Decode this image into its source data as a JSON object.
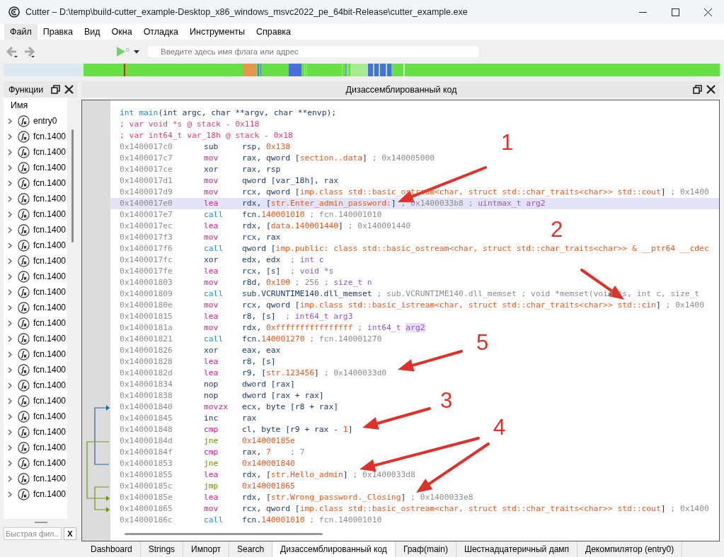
{
  "window": {
    "title": "Cutter – D:\\temp\\build-cutter_example-Desktop_x86_windows_msvc2022_pe_64bit-Release\\cutter_example.exe"
  },
  "menu": [
    {
      "label": "Файл",
      "selected": true
    },
    {
      "label": "Правка",
      "selected": false
    },
    {
      "label": "Вид",
      "selected": false
    },
    {
      "label": "Окна",
      "selected": false
    },
    {
      "label": "Отладка",
      "selected": false
    },
    {
      "label": "Инструменты",
      "selected": false
    },
    {
      "label": "Справка",
      "selected": false
    }
  ],
  "toolbar": {
    "debug_badge": "D",
    "search": {
      "placeholder": "Введите здесь имя флага или адрес"
    }
  },
  "functions_panel": {
    "title": "Функции",
    "column": "Имя",
    "items": [
      {
        "name": "entry0",
        "expanded": false
      },
      {
        "name": "fcn.1400",
        "expanded": false
      },
      {
        "name": "fcn.1400",
        "expanded": false
      },
      {
        "name": "fcn.1400",
        "expanded": false
      },
      {
        "name": "fcn.1400",
        "expanded": false
      },
      {
        "name": "fcn.1400",
        "expanded": false
      },
      {
        "name": "fcn.1400",
        "expanded": false
      },
      {
        "name": "fcn.1400",
        "expanded": false
      },
      {
        "name": "fcn.1400",
        "expanded": false
      },
      {
        "name": "fcn.1400",
        "expanded": false
      },
      {
        "name": "fcn.1400",
        "expanded": false
      },
      {
        "name": "fcn.1400",
        "expanded": false
      },
      {
        "name": "fcn.1400",
        "expanded": false
      },
      {
        "name": "fcn.1400",
        "expanded": false
      },
      {
        "name": "fcn.1400",
        "expanded": false
      },
      {
        "name": "fcn.1400",
        "expanded": false
      },
      {
        "name": "fcn.1400",
        "expanded": false
      },
      {
        "name": "fcn.1400",
        "expanded": false
      },
      {
        "name": "fcn.1400",
        "expanded": false
      },
      {
        "name": "fcn.1400",
        "expanded": false
      },
      {
        "name": "fcn.1400",
        "expanded": false
      },
      {
        "name": "fcn.1400",
        "expanded": false
      },
      {
        "name": "fcn.1400",
        "expanded": false
      },
      {
        "name": "fcn.1400",
        "expanded": false
      },
      {
        "name": "fcn.1400",
        "expanded": false
      }
    ],
    "filter": {
      "placeholder": "Быстрая фил..."
    },
    "clear_button": "X"
  },
  "disassembly": {
    "title": "Дизассемблированный код",
    "header": [
      [
        {
          "text": "int main",
          "kind": "kw"
        },
        {
          "text": "(int argc, char **argv, char **envp);",
          "kind": "reg"
        }
      ],
      [
        {
          "text": "; var void *s @ stack - 0x118",
          "kind": "var"
        }
      ],
      [
        {
          "text": "; var int64_t var_18h @ stack - 0x18",
          "kind": "var"
        }
      ]
    ],
    "rows": [
      {
        "address": "0x1400017c0",
        "mnemonic": "sub",
        "kind": "arith",
        "selected": false,
        "ops": [
          {
            "text": "rsp, ",
            "kind": "reg"
          },
          {
            "text": "0x138",
            "kind": "num"
          }
        ]
      },
      {
        "address": "0x1400017c7",
        "mnemonic": "mov",
        "kind": "move",
        "selected": false,
        "ops": [
          {
            "text": "rax, qword [",
            "kind": "reg"
          },
          {
            "text": "section..data",
            "kind": "num"
          },
          {
            "text": "]",
            "kind": "reg"
          },
          {
            "text": " ; 0x140005000",
            "kind": "cmt"
          }
        ]
      },
      {
        "address": "0x1400017ce",
        "mnemonic": "xor",
        "kind": "arith",
        "selected": false,
        "ops": [
          {
            "text": "rax, rsp",
            "kind": "reg"
          }
        ]
      },
      {
        "address": "0x1400017d1",
        "mnemonic": "mov",
        "kind": "move",
        "selected": false,
        "ops": [
          {
            "text": "qword [var_18h], rax",
            "kind": "reg"
          }
        ]
      },
      {
        "address": "0x1400017d9",
        "mnemonic": "mov",
        "kind": "move",
        "selected": false,
        "ops": [
          {
            "text": "rcx, qword [",
            "kind": "reg"
          },
          {
            "text": "imp.class std::basic_ostream<char, struct std::char_traits<char>> std::cout",
            "kind": "num"
          },
          {
            "text": "]",
            "kind": "reg"
          },
          {
            "text": " ; 0x1400",
            "kind": "cmt"
          }
        ]
      },
      {
        "address": "0x1400017e0",
        "mnemonic": "lea",
        "kind": "move",
        "selected": true,
        "ops": [
          {
            "text": "rdx, [",
            "kind": "reg"
          },
          {
            "text": "str.Enter_admin_password:",
            "kind": "num"
          },
          {
            "text": "]",
            "kind": "reg"
          },
          {
            "text": " ; 0x1400033b8 ;",
            "kind": "cmt"
          },
          {
            "text": " uintmax_t ",
            "kind": "type"
          },
          {
            "text": "arg2",
            "kind": "arg"
          }
        ]
      },
      {
        "address": "0x1400017e7",
        "mnemonic": "call",
        "kind": "call",
        "selected": false,
        "ops": [
          {
            "text": "fcn.",
            "kind": "reg"
          },
          {
            "text": "140001010",
            "kind": "num"
          },
          {
            "text": " ; fcn.140001010",
            "kind": "cmt"
          }
        ]
      },
      {
        "address": "0x1400017ec",
        "mnemonic": "lea",
        "kind": "move",
        "selected": false,
        "ops": [
          {
            "text": "rdx, [",
            "kind": "reg"
          },
          {
            "text": "data.140001440",
            "kind": "num"
          },
          {
            "text": "]",
            "kind": "reg"
          },
          {
            "text": " ; 0x140001440",
            "kind": "cmt"
          }
        ]
      },
      {
        "address": "0x1400017f3",
        "mnemonic": "mov",
        "kind": "move",
        "selected": false,
        "ops": [
          {
            "text": "rcx, rax",
            "kind": "reg"
          }
        ]
      },
      {
        "address": "0x1400017f6",
        "mnemonic": "call",
        "kind": "call",
        "selected": false,
        "ops": [
          {
            "text": "qword [",
            "kind": "reg"
          },
          {
            "text": "imp.public: class std::basic_ostream<char, struct std::char_traits<char>> & __ptr64 __cdec",
            "kind": "num"
          }
        ]
      },
      {
        "address": "0x1400017fc",
        "mnemonic": "xor",
        "kind": "arith",
        "selected": false,
        "ops": [
          {
            "text": "edx, edx",
            "kind": "reg"
          },
          {
            "text": "  ;",
            "kind": "cmt"
          },
          {
            "text": " int c",
            "kind": "type"
          }
        ]
      },
      {
        "address": "0x1400017fe",
        "mnemonic": "lea",
        "kind": "move",
        "selected": false,
        "ops": [
          {
            "text": "rcx, [s]",
            "kind": "reg"
          },
          {
            "text": "  ;",
            "kind": "cmt"
          },
          {
            "text": " void *s",
            "kind": "type"
          }
        ]
      },
      {
        "address": "0x140001803",
        "mnemonic": "mov",
        "kind": "move",
        "selected": false,
        "ops": [
          {
            "text": "r8d, ",
            "kind": "reg"
          },
          {
            "text": "0x100",
            "kind": "num"
          },
          {
            "text": " ; 256 ;",
            "kind": "cmt"
          },
          {
            "text": " size_t n",
            "kind": "type"
          }
        ]
      },
      {
        "address": "0x140001809",
        "mnemonic": "call",
        "kind": "call",
        "selected": false,
        "ops": [
          {
            "text": "sub.VCRUNTIME140.dll_memset",
            "kind": "reg"
          },
          {
            "text": " ; sub.VCRUNTIME140.dll_memset ; void *memset(void *s, int c, size_t",
            "kind": "cmt"
          }
        ]
      },
      {
        "address": "0x14000180e",
        "mnemonic": "mov",
        "kind": "move",
        "selected": false,
        "ops": [
          {
            "text": "rcx, qword [",
            "kind": "reg"
          },
          {
            "text": "imp.class std::basic_istream<char, struct std::char_traits<char>> std::cin",
            "kind": "num"
          },
          {
            "text": "]",
            "kind": "reg"
          },
          {
            "text": " ; 0x1400",
            "kind": "cmt"
          }
        ]
      },
      {
        "address": "0x140001815",
        "mnemonic": "lea",
        "kind": "move",
        "selected": false,
        "ops": [
          {
            "text": "r8, [s]",
            "kind": "reg"
          },
          {
            "text": "  ;",
            "kind": "cmt"
          },
          {
            "text": " int64_t arg3",
            "kind": "type"
          }
        ]
      },
      {
        "address": "0x14000181a",
        "mnemonic": "mov",
        "kind": "move",
        "selected": false,
        "ops": [
          {
            "text": "rdx, ",
            "kind": "reg"
          },
          {
            "text": "0xffffffffffffffff",
            "kind": "num"
          },
          {
            "text": " ;",
            "kind": "cmt"
          },
          {
            "text": " int64_t ",
            "kind": "type"
          },
          {
            "text": "arg2",
            "kind": "arg"
          }
        ]
      },
      {
        "address": "0x140001821",
        "mnemonic": "call",
        "kind": "call",
        "selected": false,
        "ops": [
          {
            "text": "fcn.",
            "kind": "reg"
          },
          {
            "text": "140001270",
            "kind": "num"
          },
          {
            "text": " ; fcn.140001270",
            "kind": "cmt"
          }
        ]
      },
      {
        "address": "0x140001826",
        "mnemonic": "xor",
        "kind": "arith",
        "selected": false,
        "ops": [
          {
            "text": "eax, eax",
            "kind": "reg"
          }
        ]
      },
      {
        "address": "0x140001828",
        "mnemonic": "lea",
        "kind": "move",
        "selected": false,
        "ops": [
          {
            "text": "r8, [s]",
            "kind": "reg"
          }
        ]
      },
      {
        "address": "0x14000182d",
        "mnemonic": "lea",
        "kind": "move",
        "selected": false,
        "ops": [
          {
            "text": "r9, [",
            "kind": "reg"
          },
          {
            "text": "str.123456",
            "kind": "num"
          },
          {
            "text": "]",
            "kind": "reg"
          },
          {
            "text": " ; 0x1400033d0",
            "kind": "cmt"
          }
        ]
      },
      {
        "address": "0x140001834",
        "mnemonic": "nop",
        "kind": "arith",
        "selected": false,
        "ops": [
          {
            "text": "dword [rax]",
            "kind": "reg"
          }
        ]
      },
      {
        "address": "0x140001838",
        "mnemonic": "nop",
        "kind": "arith",
        "selected": false,
        "ops": [
          {
            "text": "dword [rax + rax]",
            "kind": "reg"
          }
        ]
      },
      {
        "address": "0x140001840",
        "mnemonic": "movzx",
        "kind": "move",
        "selected": false,
        "ops": [
          {
            "text": "ecx, byte [r8 + rax]",
            "kind": "reg"
          }
        ]
      },
      {
        "address": "0x140001845",
        "mnemonic": "inc",
        "kind": "arith",
        "selected": false,
        "ops": [
          {
            "text": "rax",
            "kind": "reg"
          }
        ]
      },
      {
        "address": "0x140001848",
        "mnemonic": "cmp",
        "kind": "move",
        "selected": false,
        "ops": [
          {
            "text": "cl, byte [r9 + rax - ",
            "kind": "reg"
          },
          {
            "text": "1",
            "kind": "num"
          },
          {
            "text": "]",
            "kind": "reg"
          }
        ]
      },
      {
        "address": "0x14000184d",
        "mnemonic": "jne",
        "kind": "jump",
        "selected": false,
        "ops": [
          {
            "text": "0x14000185e",
            "kind": "num"
          }
        ]
      },
      {
        "address": "0x14000184f",
        "mnemonic": "cmp",
        "kind": "move",
        "selected": false,
        "ops": [
          {
            "text": "rax, ",
            "kind": "reg"
          },
          {
            "text": "7",
            "kind": "num"
          },
          {
            "text": "    ; 7",
            "kind": "cmt"
          }
        ]
      },
      {
        "address": "0x140001853",
        "mnemonic": "jne",
        "kind": "jump",
        "selected": false,
        "ops": [
          {
            "text": "0x140001840",
            "kind": "num"
          }
        ]
      },
      {
        "address": "0x140001855",
        "mnemonic": "lea",
        "kind": "move",
        "selected": false,
        "ops": [
          {
            "text": "rdx, [",
            "kind": "reg"
          },
          {
            "text": "str.Hello_admin",
            "kind": "num"
          },
          {
            "text": "]",
            "kind": "reg"
          },
          {
            "text": " ; 0x1400033d8",
            "kind": "cmt"
          }
        ]
      },
      {
        "address": "0x14000185c",
        "mnemonic": "jmp",
        "kind": "jump",
        "selected": false,
        "ops": [
          {
            "text": "0x140001865",
            "kind": "num"
          }
        ]
      },
      {
        "address": "0x14000185e",
        "mnemonic": "lea",
        "kind": "move",
        "selected": false,
        "ops": [
          {
            "text": "rdx, [",
            "kind": "reg"
          },
          {
            "text": "str.Wrong_password._Closing",
            "kind": "num"
          },
          {
            "text": "]",
            "kind": "reg"
          },
          {
            "text": " ; 0x1400033e8",
            "kind": "cmt"
          }
        ]
      },
      {
        "address": "0x140001865",
        "mnemonic": "mov",
        "kind": "move",
        "selected": false,
        "ops": [
          {
            "text": "rcx, qword [",
            "kind": "reg"
          },
          {
            "text": "imp.class std::basic_ostream<char, struct std::char_traits<char>> std::cout",
            "kind": "num"
          },
          {
            "text": "]",
            "kind": "reg"
          },
          {
            "text": " ; 0x1400",
            "kind": "cmt"
          }
        ]
      },
      {
        "address": "0x14000186c",
        "mnemonic": "call",
        "kind": "call",
        "selected": false,
        "ops": [
          {
            "text": "fcn.",
            "kind": "reg"
          },
          {
            "text": "140001010",
            "kind": "num"
          },
          {
            "text": " ; fcn.140001010",
            "kind": "cmt"
          }
        ]
      }
    ]
  },
  "annotations": [
    {
      "label": "1"
    },
    {
      "label": "2"
    },
    {
      "label": "5"
    },
    {
      "label": "3"
    },
    {
      "label": "4"
    }
  ],
  "tabs": [
    {
      "label": "Dashboard",
      "selected": false
    },
    {
      "label": "Strings",
      "selected": false
    },
    {
      "label": "Импорт",
      "selected": false
    },
    {
      "label": "Search",
      "selected": false
    },
    {
      "label": "Дизассемблированный код",
      "selected": true
    },
    {
      "label": "Граф(main)",
      "selected": false
    },
    {
      "label": "Шестнадцатеричный дамп",
      "selected": false
    },
    {
      "label": "Декомпилятор (entry0)",
      "selected": false
    }
  ]
}
